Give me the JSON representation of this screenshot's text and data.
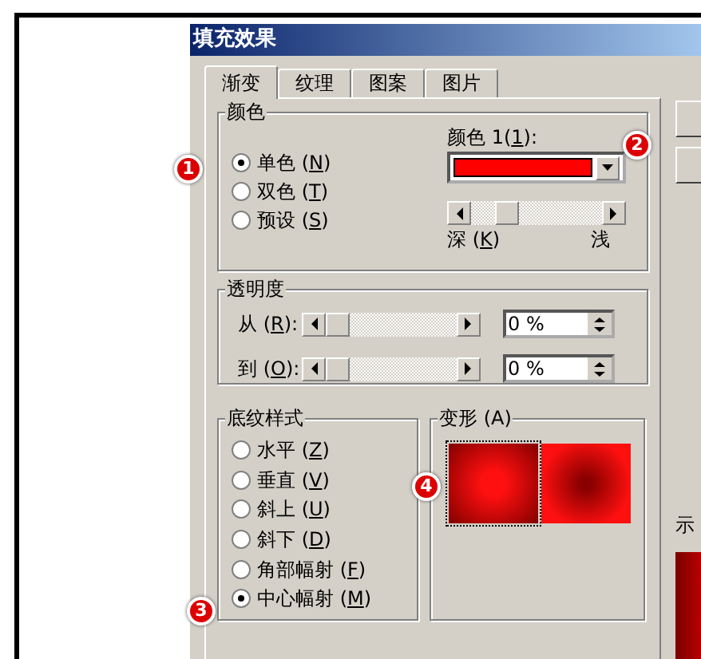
{
  "window": {
    "title": "填充效果"
  },
  "tabs": [
    {
      "label": "渐变",
      "selected": true
    },
    {
      "label": "纹理",
      "selected": false
    },
    {
      "label": "图案",
      "selected": false
    },
    {
      "label": "图片",
      "selected": false
    }
  ],
  "color_group": {
    "title": "颜色",
    "options": [
      {
        "label": "单色 (N)",
        "selected": true
      },
      {
        "label": "双色 (T)",
        "selected": false
      },
      {
        "label": "预设 (S)",
        "selected": false
      }
    ],
    "color1": {
      "label": "颜色 1(1):",
      "color": "#ff0000"
    },
    "shade": {
      "level": 0.22,
      "dark_label": "深 (K)",
      "light_label": "浅"
    }
  },
  "transparency_group": {
    "title": "透明度",
    "rows": [
      {
        "label": "从 (R):",
        "level": 0,
        "value": "0 %"
      },
      {
        "label": "到 (O):",
        "level": 0,
        "value": "0 %"
      }
    ]
  },
  "shading_group": {
    "title": "底纹样式",
    "options": [
      {
        "label": "水平 (Z)",
        "selected": false
      },
      {
        "label": "垂直 (V)",
        "selected": false
      },
      {
        "label": "斜上 (U)",
        "selected": false
      },
      {
        "label": "斜下 (D)",
        "selected": false
      },
      {
        "label": "角部幅射 (F)",
        "selected": false
      },
      {
        "label": "中心幅射 (M)",
        "selected": true
      }
    ]
  },
  "variants_group": {
    "title": "变形 (A)",
    "variants": [
      {
        "kind": "center_light",
        "selected": true
      },
      {
        "kind": "center_dark",
        "selected": false
      }
    ]
  },
  "sample": {
    "label": "示"
  },
  "callouts": [
    "1",
    "2",
    "3",
    "4"
  ]
}
